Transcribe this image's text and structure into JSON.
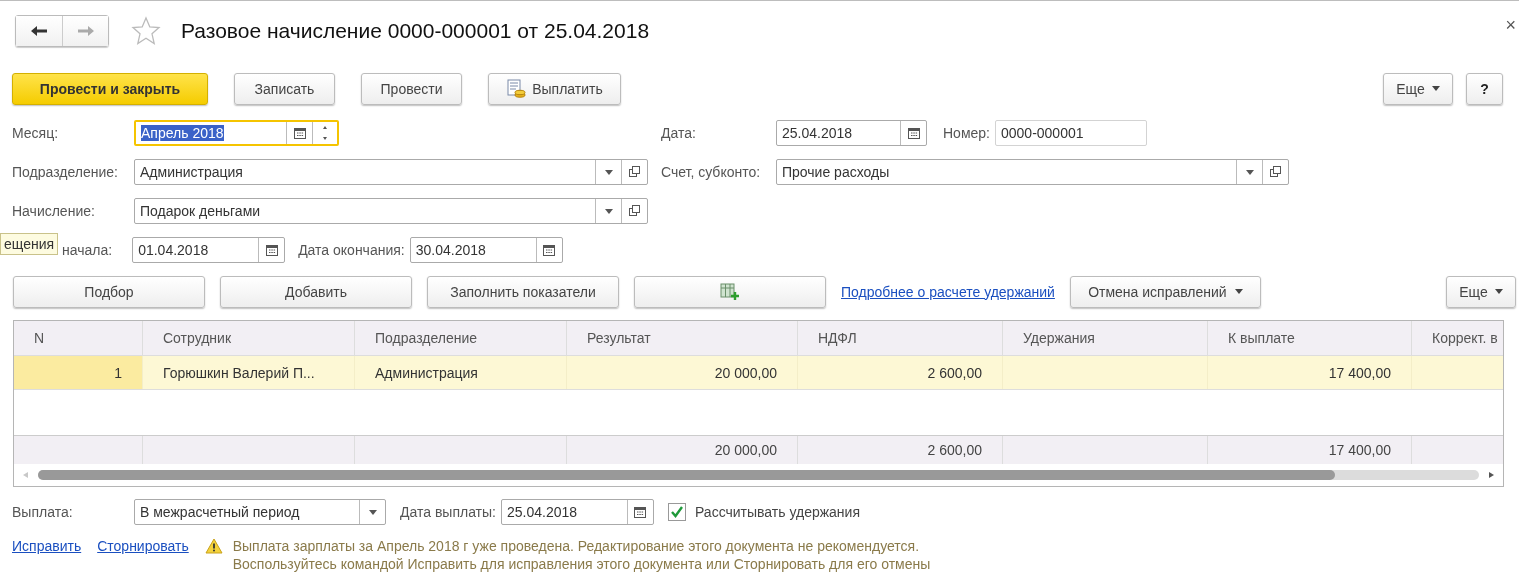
{
  "header": {
    "title": "Разовое начисление 0000-000001 от 25.04.2018",
    "favorite": false,
    "close": "×"
  },
  "toolbar": {
    "buttons": [
      {
        "kind": "primary",
        "label": "Провести и закрыть"
      },
      {
        "kind": "plain",
        "label": "Записать"
      },
      {
        "kind": "plain",
        "label": "Провести"
      },
      {
        "kind": "icon",
        "label": "Выплатить"
      }
    ],
    "more": "Еще",
    "help": "?"
  },
  "form": {
    "month": {
      "label": "Месяц:",
      "value": "Апрель 2018",
      "focused": true,
      "text_selected": true
    },
    "date": {
      "label": "Дата:",
      "value": "25.04.2018"
    },
    "number": {
      "label": "Номер:",
      "value": "0000-000001"
    },
    "department": {
      "label": "Подразделение:",
      "value": "Администрация"
    },
    "account": {
      "label": "Счет, субконто:",
      "value": "Прочие расходы"
    },
    "accrual": {
      "label": "Начисление:",
      "value": "Подарок деньгами"
    },
    "start": {
      "label": "начала:",
      "value": "01.04.2018"
    },
    "end": {
      "label": "Дата окончания:",
      "value": "30.04.2018"
    }
  },
  "tooltip": "ещения",
  "table_toolbar": {
    "buttons": [
      {
        "kind": "text",
        "label": "Подбор"
      },
      {
        "kind": "text",
        "label": "Добавить"
      },
      {
        "kind": "text",
        "label": "Заполнить показатели"
      },
      {
        "kind": "icon"
      }
    ],
    "link": "Подробнее о расчете удержаний",
    "dropdown": "Отмена исправлений",
    "more": "Еще"
  },
  "table": {
    "columns": [
      "N",
      "Сотрудник",
      "Подразделение",
      "Результат",
      "НДФЛ",
      "Удержания",
      "К выплате",
      "Коррект. в"
    ],
    "rows": [
      {
        "selected": true,
        "n": "1",
        "employee": "Горюшкин Валерий П...",
        "department": "Администрация",
        "result": "20 000,00",
        "ndfl": "2 600,00",
        "payable": "17 400,00"
      }
    ],
    "totals": {
      "result": "20 000,00",
      "ndfl": "2 600,00",
      "payable": "17 400,00"
    }
  },
  "payment": {
    "label": "Выплата:",
    "value": "В межрасчетный период"
  },
  "pay_date": {
    "label": "Дата выплаты:",
    "value": "25.04.2018"
  },
  "calc_deductions": {
    "label": "Рассчитывать удержания",
    "checked": true
  },
  "links": [
    "Исправить",
    "Сторнировать"
  ],
  "warning": [
    "Выплата зарплаты за Апрель 2018 г уже проведена. Редактирование этого документа не рекомендуется.",
    "Воспользуйтесь командой Исправить для исправления этого документа или Сторнировать для его отмены"
  ]
}
